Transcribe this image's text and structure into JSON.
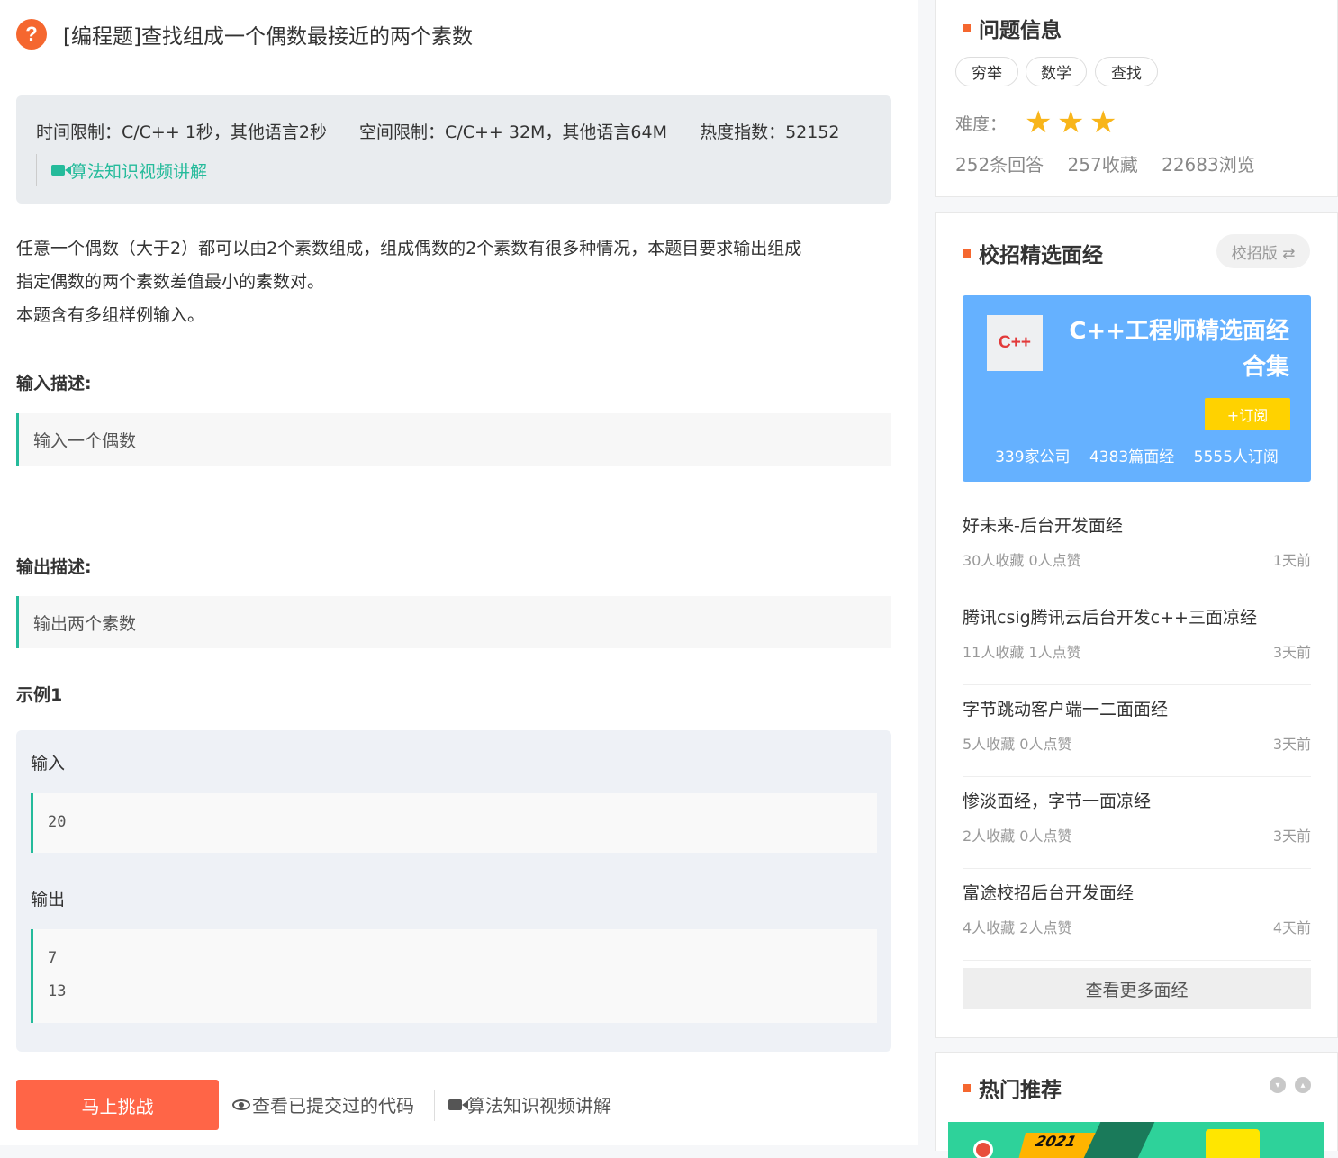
{
  "problem": {
    "title": "[编程题]查找组成一个偶数最接近的两个素数",
    "time_limit": "时间限制：C/C++ 1秒，其他语言2秒",
    "space_limit": "空间限制：C/C++ 32M，其他语言64M",
    "hot_index": "热度指数：52152",
    "video_link": "算法知识视频讲解",
    "desc_line1": "任意一个偶数（大于2）都可以由2个素数组成，组成偶数的2个素数有很多种情况，本题目要求输出组成",
    "desc_line2": "指定偶数的两个素数差值最小的素数对。",
    "desc_line3": "本题含有多组样例输入。",
    "input_heading": "输入描述:",
    "input_desc": "输入一个偶数",
    "output_heading": "输出描述:",
    "output_desc": "输出两个素数",
    "example_heading": "示例1",
    "example_input_label": "输入",
    "example_input": "20",
    "example_output_label": "输出",
    "example_output_line1": "7",
    "example_output_line2": "13",
    "challenge_button": "马上挑战",
    "view_code_link": "查看已提交过的代码",
    "bottom_video_link": "算法知识视频讲解"
  },
  "problem_info": {
    "heading": "问题信息",
    "tags": [
      "穷举",
      "数学",
      "查找"
    ],
    "difficulty_label": "难度：",
    "difficulty_stars": 3,
    "answers": "252条回答",
    "favorites": "257收藏",
    "views": "22683浏览"
  },
  "interviews": {
    "heading": "校招精选面经",
    "version_button": "校招版 ⇄",
    "banner": {
      "logo": "C++",
      "title_line1": "C++工程师精选面经",
      "title_line2": "合集",
      "subscribe": "+订阅",
      "companies": "339家公司",
      "articles": "4383篇面经",
      "subscribers": "5555人订阅"
    },
    "items": [
      {
        "title": "好未来-后台开发面经",
        "meta": "30人收藏 0人点赞",
        "time": "1天前"
      },
      {
        "title": "腾讯csig腾讯云后台开发c++三面凉经",
        "meta": "11人收藏 1人点赞",
        "time": "3天前"
      },
      {
        "title": "字节跳动客户端一二面面经",
        "meta": "5人收藏 0人点赞",
        "time": "3天前"
      },
      {
        "title": "惨淡面经，字节一面凉经",
        "meta": "2人收藏 0人点赞",
        "time": "3天前"
      },
      {
        "title": "富途校招后台开发面经",
        "meta": "4人收藏 2人点赞",
        "time": "4天前"
      }
    ],
    "more_button": "查看更多面经"
  },
  "hot": {
    "heading": "热门推荐",
    "banner_year": "2021"
  },
  "colors": {
    "accent_orange": "#f5672f",
    "accent_green": "#25bb9b",
    "button_red": "#ff6547",
    "banner_blue": "#65b1ff",
    "star_yellow": "#f8b51a"
  }
}
